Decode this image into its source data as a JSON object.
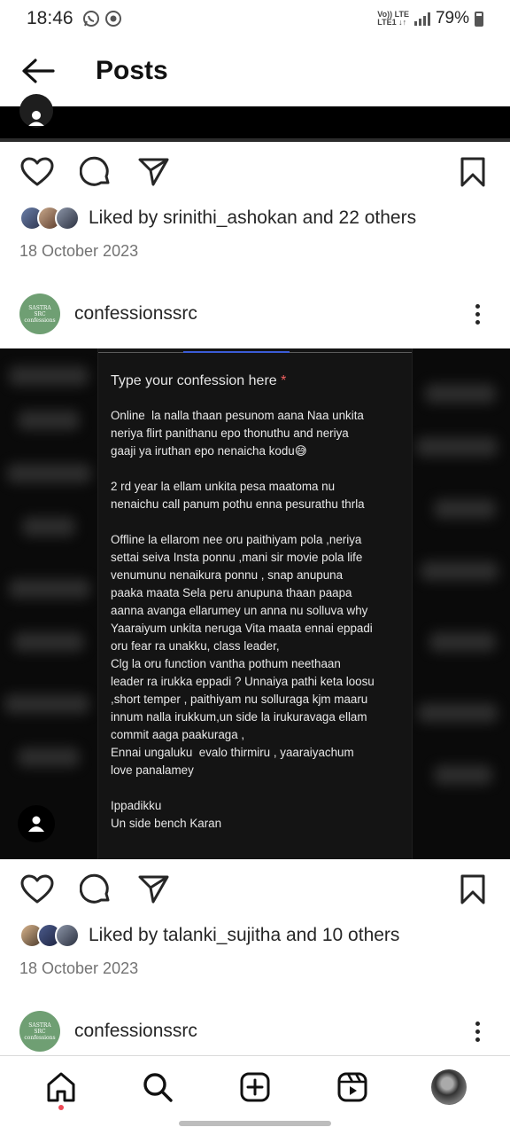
{
  "status_bar": {
    "time": "18:46",
    "network_line1": "Vo)) LTE",
    "network_line2": "LTE1 ↓↑",
    "battery": "79%"
  },
  "header": {
    "title": "Posts",
    "back_icon": "arrow-left-icon"
  },
  "posts": [
    {
      "likes_user": "srinithi_ashokan",
      "likes_rest": " and 22 others",
      "likes_prefix": "Liked by ",
      "date": "18 October 2023"
    },
    {
      "username": "confessionssrc",
      "profile_text": [
        "SASTRA",
        "SRC",
        "confessions"
      ],
      "media": {
        "label": "Type your confession here",
        "required_mark": "*",
        "text": "Online  la nalla thaan pesunom aana Naa unkita\nneriya flirt panithanu epo thonuthu and neriya\ngaaji ya iruthan epo nenaicha kodu😅\n\n2 rd year la ellam unkita pesa maatoma nu\nnenaichu call panum pothu enna pesurathu thrla\n\nOffline la ellarom nee oru paithiyam pola ,neriya\nsettai seiva Insta ponnu ,mani sir movie pola life\nvenumunu nenaikura ponnu , snap anupuna\npaaka maata Sela peru anupuna thaan paapa\naanna avanga ellarumey un anna nu solluva why\nYaaraiyum unkita neruga Vita maata ennai eppadi\noru fear ra unakku, class leader,\nClg la oru function vantha pothum neethaan\nleader ra irukka eppadi ? Unnaiya pathi keta loosu\n,short temper , paithiyam nu solluraga kjm maaru\ninnum nalla irukkum,un side la irukuravaga ellam\ncommit aaga paakuraga ,\nEnnai ungaluku  evalo thirmiru , yaaraiyachum\nlove panalamey\n\nIppadikku\nUn side bench Karan"
      },
      "likes_prefix": "Liked by ",
      "likes_user": "talanki_sujitha",
      "likes_rest": " and 10 others",
      "date": "18 October 2023"
    },
    {
      "username": "confessionssrc",
      "profile_text": [
        "SASTRA",
        "SRC",
        "confessions"
      ]
    }
  ],
  "bottom_nav": {
    "items": [
      "home-icon",
      "search-icon",
      "create-post-icon",
      "reels-icon",
      "profile-avatar"
    ]
  },
  "colors": {
    "notification_dot": "#ed4956",
    "profile_green": "#6f9f73"
  }
}
